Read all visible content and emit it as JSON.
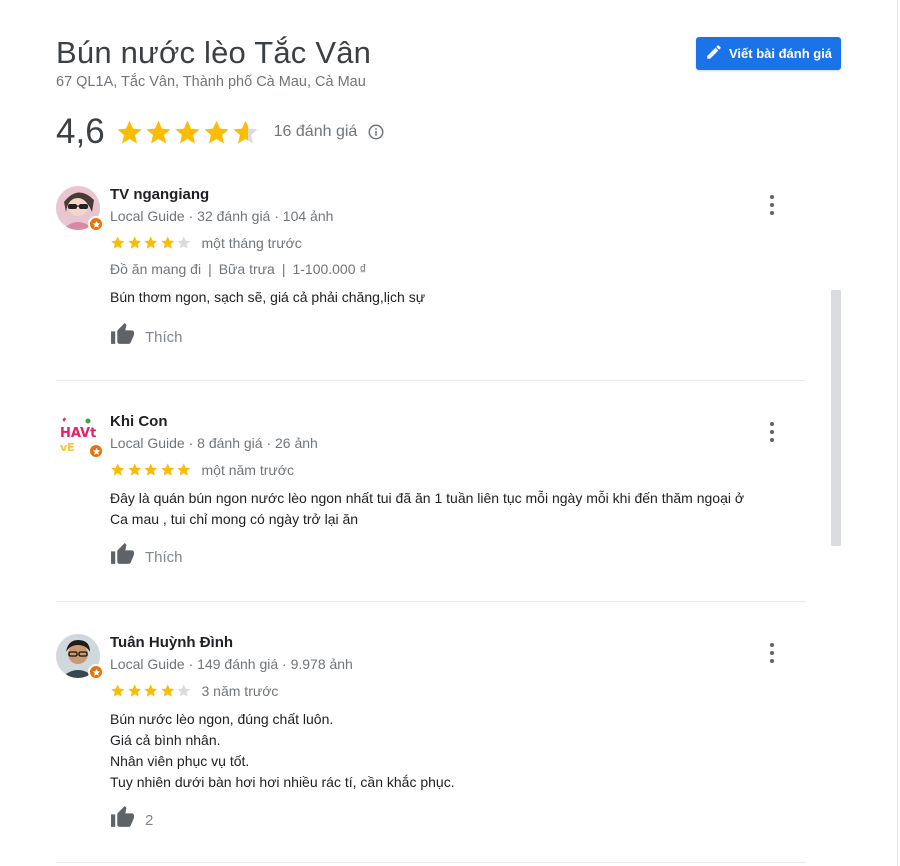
{
  "place": {
    "name": "Bún nước lèo Tắc Vân",
    "address": "67 QL1A, Tắc Vân, Thành phố Cà Mau, Cà Mau",
    "average_rating": "4,6",
    "rating_value": 4.6,
    "review_count_label": "16 đánh giá"
  },
  "actions": {
    "write_review_label": "Viết bài đánh giá"
  },
  "colors": {
    "accent": "#1a73e8",
    "star": "#fbbc04",
    "star_empty": "#dadce0",
    "local_guide_badge": "#e8710a"
  },
  "reviews": [
    {
      "name": "TV ngangiang",
      "meta": "Local Guide · 32 đánh giá · 104 ảnh",
      "rating": 4,
      "when": "một tháng trước",
      "tags": [
        "Đồ ăn mang đi",
        "Bữa trưa",
        "1-100.000 ₫"
      ],
      "text_lines": [
        "Bún thơm ngon, sạch sẽ, giá cả phải chăng,lịch sự"
      ],
      "like_label": "Thích"
    },
    {
      "name": "Khi Con",
      "meta": "Local Guide · 8 đánh giá · 26 ảnh",
      "rating": 5,
      "when": "một năm trước",
      "text_lines": [
        "Đây là quán bún ngon nước lèo ngon nhất tui đã ăn 1 tuần liên tục mỗi ngày mỗi khi đến thăm ngoại ở",
        "Ca mau , tui chỉ mong có ngày trở lại ăn"
      ],
      "like_label": "Thích"
    },
    {
      "name": "Tuân Huỳnh Đình",
      "meta": "Local Guide · 149 đánh giá · 9.978 ảnh",
      "rating": 4,
      "when": "3 năm trước",
      "text_lines": [
        "Bún nước lèo ngon, đúng chất luôn.",
        "Giá cả bình nhân.",
        "Nhân viên phục vụ tốt.",
        "Tuy nhiên dưới bàn hơi hơi nhiều rác tí, cần khắc phục."
      ],
      "like_label": "2"
    }
  ]
}
